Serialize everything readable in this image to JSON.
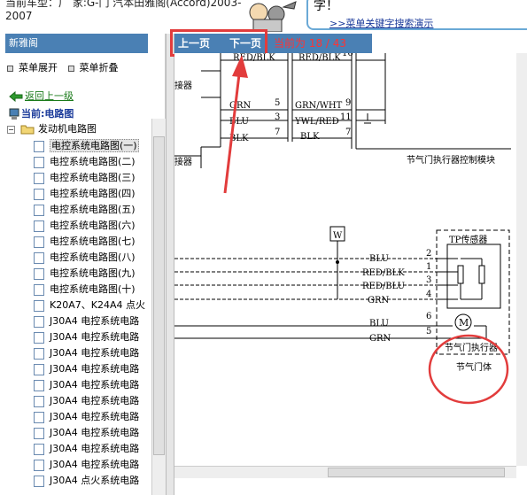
{
  "header": {
    "vehicle_line1": "当前车型：广 家:G-门 汽本田雅阁(Accord)2003-",
    "vehicle_line2": "2007",
    "bubble_char": "字！",
    "demo_link": ">>菜单关键字搜索演示"
  },
  "left_panel": {
    "title": "新雅阁",
    "expand_label": "菜单展开",
    "collapse_label": "菜单折叠",
    "back_label": "返回上一级",
    "current_label": "当前:电路图",
    "folder_label": "发动机电路图",
    "items": [
      "电控系统电路图(一)",
      "电控系统电路图(二)",
      "电控系统电路图(三)",
      "电控系统电路图(四)",
      "电控系统电路图(五)",
      "电控系统电路图(六)",
      "电控系统电路图(七)",
      "电控系统电路图(八)",
      "电控系统电路图(九)",
      "电控系统电路图(十)",
      "K20A7、K24A4 点火",
      "J30A4 电控系统电路",
      "J30A4 电控系统电路",
      "J30A4 电控系统电路",
      "J30A4 电控系统电路",
      "J30A4 电控系统电路",
      "J30A4 电控系统电路",
      "J30A4 电控系统电路",
      "J30A4 电控系统电路",
      "J30A4 电控系统电路",
      "J30A4 电控系统电路",
      "J30A4 点火系统电路"
    ],
    "selected_index": 0
  },
  "nav": {
    "prev_label": "上一页",
    "next_label": "下一页",
    "page_status": "当前为 18 / 43"
  },
  "diagram": {
    "top_wires_left": [
      "RED/BLK",
      "GRN",
      "BLU",
      "BLK"
    ],
    "top_pins_left": [
      "5",
      "3",
      "7"
    ],
    "top_wires_right": [
      "RED/BLK",
      "GRN/WHT",
      "YWL/RED",
      "BLK"
    ],
    "top_pins_right": [
      "9",
      "11",
      "7"
    ],
    "connector_label_1": "接器",
    "connector_label_2": "接器",
    "pin_top": "16",
    "module_label": "节气门执行器控制模块",
    "w_label": "W",
    "sensor_wires": [
      "BLU",
      "RED/BLK",
      "RED/BLU",
      "GRN"
    ],
    "sensor_pins": [
      "2",
      "1",
      "3",
      "4"
    ],
    "motor_wires": [
      "BLU",
      "GRN"
    ],
    "motor_pins": [
      "6",
      "5"
    ],
    "tp_sensor_label": "TP传感器",
    "motor_symbol": "M",
    "actuator_label": "节气门执行器",
    "body_label": "节气门体",
    "annotation_color": "#e23c3c",
    "nav_color": "#4a80b4"
  }
}
